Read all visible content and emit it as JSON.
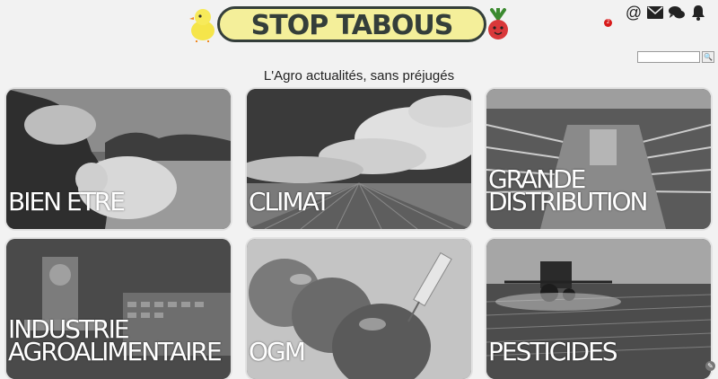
{
  "header": {
    "logo_text": "STOP TABOUS",
    "notification_count": "2",
    "icons": [
      "at-icon",
      "envelope-icon",
      "comments-icon",
      "bell-icon"
    ]
  },
  "search": {
    "placeholder": "",
    "button_label": "🔍"
  },
  "tagline": "L'Agro actualités, sans préjugés",
  "tiles": [
    {
      "label": "BIEN ETRE",
      "icon": "farmer-with-piglet"
    },
    {
      "label": "CLIMAT",
      "icon": "cloudy-sky-field"
    },
    {
      "label": "GRANDE DISTRIBUTION",
      "icon": "supermarket-aisle"
    },
    {
      "label": "INDUSTRIE AGROALIMENTAIRE",
      "icon": "food-machinery"
    },
    {
      "label": "OGM",
      "icon": "tomatoes-syringe"
    },
    {
      "label": "PESTICIDES",
      "icon": "tractor-spraying"
    }
  ]
}
